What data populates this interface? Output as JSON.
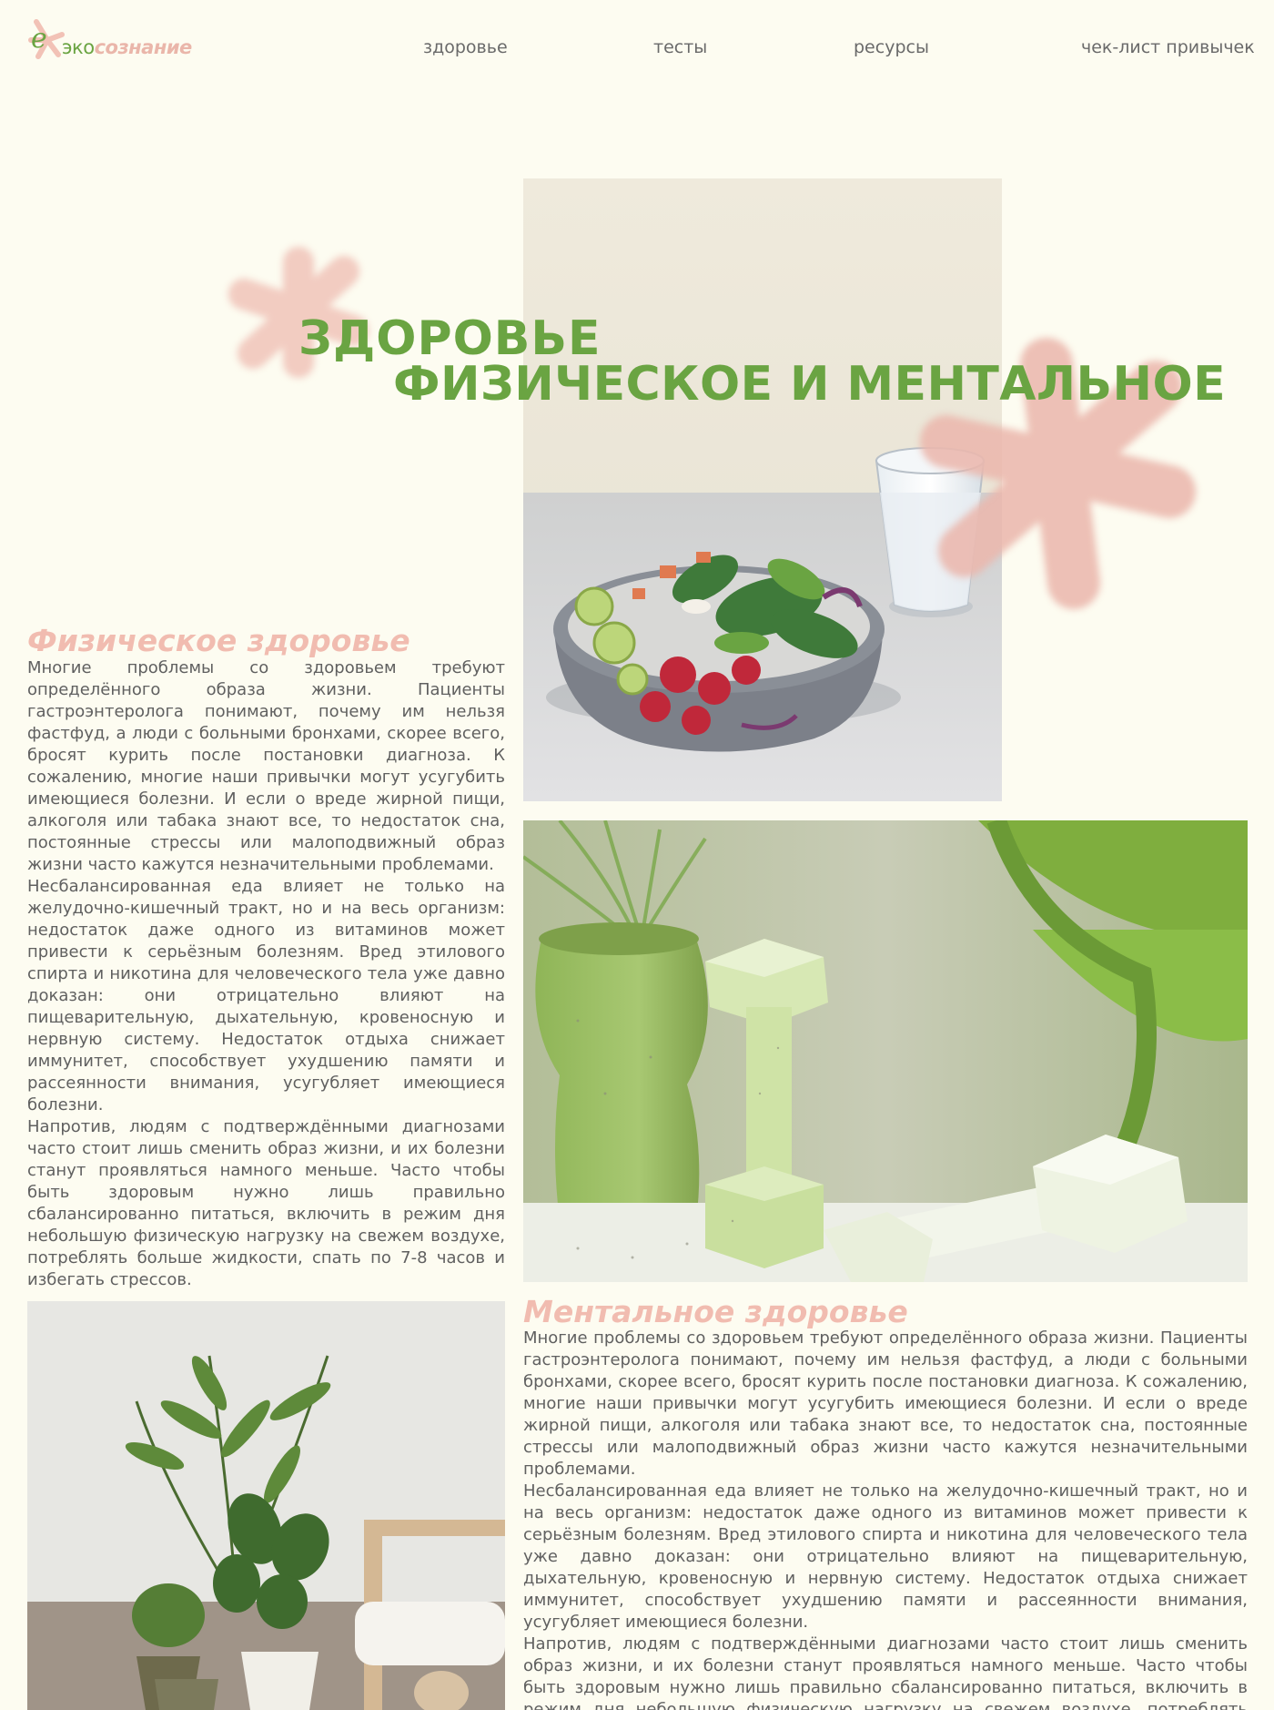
{
  "header": {
    "logo_letter": "е",
    "logo_eco": "эко",
    "logo_consciousness": "сознание",
    "nav": [
      {
        "label": "здоровье"
      },
      {
        "label": "тесты"
      },
      {
        "label": "ресурсы"
      },
      {
        "label": "чек-лист привычек"
      }
    ]
  },
  "hero": {
    "title_line1": "ЗДОРОВЬЕ",
    "title_line2": "ФИЗИЧЕСКОЕ И МЕНТАЛЬНОЕ"
  },
  "physical": {
    "heading": "Физическое здоровье",
    "paragraphs": [
      "Многие проблемы со здоровьем требуют определённого образа жизни. Пациенты гастроэнтеролога понимают, почему им нельзя фастфуд, а люди с больными бронхами, скорее всего, бросят курить после постановки диагноза. К сожалению, многие наши привычки могут усугубить имеющиеся болезни. И если о вреде жирной пищи, алкоголя или табака знают все, то недостаток сна, постоянные стрессы или малоподвижный образ жизни часто кажутся незначительными проблемами.",
      "Несбалансированная еда влияет не только на желудочно-кишечный тракт, но и на весь организм: недостаток даже одного из витаминов может привести к серьёзным болезням. Вред этилового спирта и никотина для человеческого тела уже давно доказан: они отрицательно влияют на пищеварительную, дыхательную, кровеносную и нервную систему. Недостаток отдыха снижает иммунитет, способствует ухудшению памяти и рассеянности внимания, усугубляет имеющиеся болезни.",
      "Напротив, людям с подтверждёнными диагнозами часто стоит лишь сменить образ жизни, и их болезни станут проявляться намного меньше. Часто чтобы быть здоровым нужно лишь правильно сбалансированно питаться, включить в режим дня небольшую физическую нагрузку на свежем воздухе, потреблять больше жидкости, спать по 7-8 часов и избегать стрессов."
    ]
  },
  "mental": {
    "heading": "Ментальное здоровье",
    "paragraphs": [
      "Многие проблемы со здоровьем требуют определённого образа жизни. Пациенты гастроэнтеролога понимают, почему им нельзя фастфуд, а люди с больными бронхами, скорее всего, бросят курить после постановки диагноза. К сожалению, многие наши привычки могут усугубить имеющиеся болезни. И если о вреде жирной пищи, алкоголя или табака знают все, то недостаток сна, постоянные стрессы или малоподвижный образ жизни часто кажутся незначительными проблемами.",
      "Несбалансированная еда влияет не только на желудочно-кишечный тракт, но и на весь организм: недостаток даже одного из витаминов может привести к серьёзным болезням. Вред этилового спирта и никотина для человеческого тела уже давно доказан: они отрицательно влияют на пищеварительную, дыхательную, кровеносную и нервную систему. Недостаток отдыха снижает иммунитет, способствует ухудшению памяти и рассеянности внимания, усугубляет имеющиеся болезни.",
      "Напротив, людям с подтверждёнными диагнозами часто стоит лишь сменить образ жизни, и их болезни станут проявляться намного меньше. Часто чтобы быть здоровым нужно лишь правильно сбалансированно питаться, включить в режим дня небольшую физическую нагрузку на свежем воздухе, потреблять больше жидкости, спать по 7-8 часов и избегать стрессов."
    ]
  },
  "colors": {
    "background": "#fdfcf1",
    "accent_green": "#6aa442",
    "accent_pink": "#f1bcb0",
    "text": "#606060"
  },
  "icons": [
    "logo-star-icon",
    "decorative-star-icon"
  ]
}
